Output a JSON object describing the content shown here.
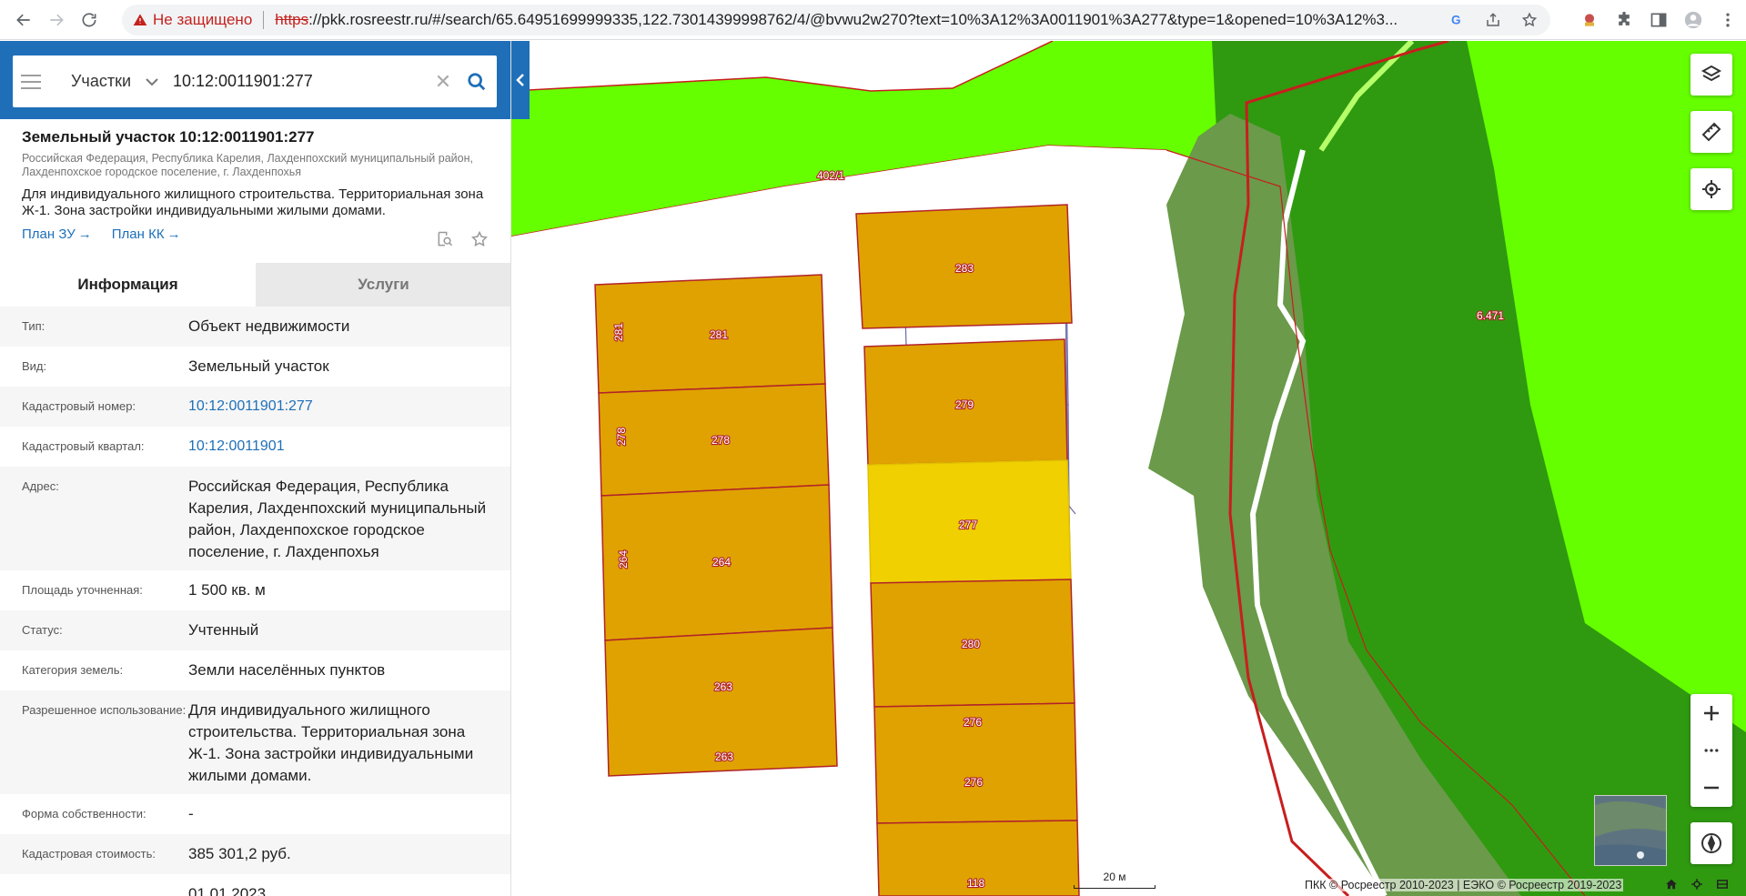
{
  "browser": {
    "security_label": "Не защищено",
    "url_scheme": "https",
    "url_rest": "://pkk.rosreestr.ru/#/search/65.64951699999335,122.73014399998762/4/@bvwu2w270?text=10%3A12%3A0011901%3A277&type=1&opened=10%3A12%3..."
  },
  "search": {
    "category": "Участки",
    "query": "10:12:0011901:277"
  },
  "object": {
    "title": "Земельный участок 10:12:0011901:277",
    "address": "Российская Федерация, Республика Карелия, Лахденпохский муниципальный район, Лахденпохское городское поселение, г. Лахденпохья",
    "use": "Для индивидуального жилищного строительства. Территориальная зона Ж-1. Зона застройки индивидуальными жилыми домами.",
    "plan_zu": "План ЗУ",
    "plan_kk": "План КК"
  },
  "tabs": {
    "info": "Информация",
    "services": "Услуги"
  },
  "rows": [
    {
      "label": "Тип:",
      "value": "Объект недвижимости"
    },
    {
      "label": "Вид:",
      "value": "Земельный участок"
    },
    {
      "label": "Кадастровый номер:",
      "value": "10:12:0011901:277"
    },
    {
      "label": "Кадастровый квартал:",
      "value": "10:12:0011901"
    },
    {
      "label": "Адрес:",
      "value": "Российская Федерация, Республика Карелия, Лахденпохский муниципальный район, Лахденпохское городское поселение, г. Лахденпохья"
    },
    {
      "label": "Площадь уточненная:",
      "value": "1 500 кв. м"
    },
    {
      "label": "Статус:",
      "value": "Учтенный"
    },
    {
      "label": "Категория земель:",
      "value": "Земли населённых пунктов"
    },
    {
      "label": "Разрешенное использование:",
      "value": "Для индивидуального жилищного строительства. Территориальная зона Ж-1. Зона застройки индивидуальными жилыми домами."
    },
    {
      "label": "Форма собственности:",
      "value": "-"
    },
    {
      "label": "Кадастровая стоимость:",
      "value": "385 301,2 руб."
    },
    {
      "label": "",
      "value": "01.01.2023"
    }
  ],
  "map": {
    "labels": {
      "p402": "402/1",
      "p283": "283",
      "p281": "281",
      "p281v": "281",
      "p278": "278",
      "p278v": "278",
      "p264": "264",
      "p264v": "264",
      "p263a": "263",
      "p263b": "263",
      "p279": "279",
      "p277": "277",
      "p280": "280",
      "p276a": "276",
      "p276b": "276",
      "p118": "118",
      "p6471": "6.471"
    },
    "scale": "20 м",
    "attribution": "ПКК © Росреестр 2010-2023 | ЕЭКО © Росреестр 2019-2023",
    "colors": {
      "green_zone": "#66ff00",
      "forest": "#2f9a10",
      "olive": "#6a9a4a",
      "parcel": "#e0a200",
      "selected": "#f0d000",
      "border_red": "#c81e1e"
    }
  }
}
